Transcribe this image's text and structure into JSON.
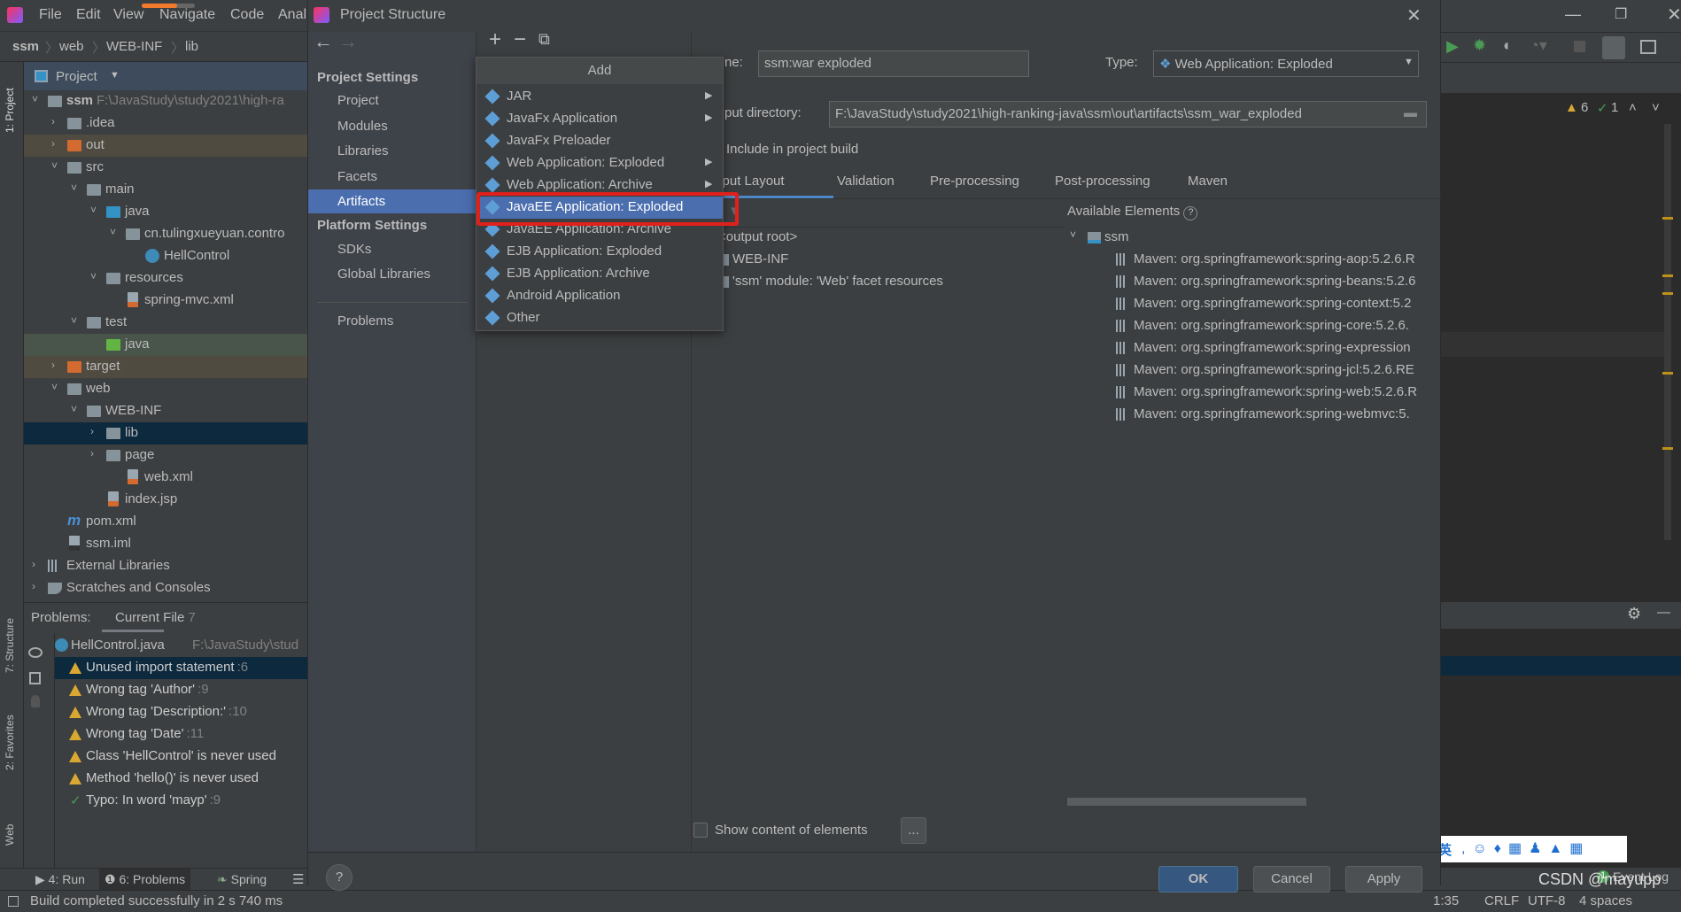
{
  "colors": {
    "selection": "#4b6eaf",
    "dark_selection": "#0d293e",
    "highlight_box": "#e0201a",
    "ok_button": "#365880",
    "excluded_row": "#4f4b41",
    "test_row": "#49544a"
  },
  "ide": {
    "menu": [
      "File",
      "Edit",
      "View",
      "Navigate",
      "Code",
      "Anal"
    ],
    "breadcrumb": [
      "ssm",
      "web",
      "WEB-INF",
      "lib"
    ],
    "left_strip": [
      "1: Project",
      "7: Structure",
      "2: Favorites",
      "Web"
    ],
    "project_header": "Project",
    "tree": [
      {
        "label": "ssm",
        "path": "F:\\JavaStudy\\study2021\\high-ra",
        "level": 0,
        "arrow": "open",
        "icon": "module-folder"
      },
      {
        "label": ".idea",
        "level": 1,
        "arrow": "closed",
        "icon": "folder"
      },
      {
        "label": "out",
        "level": 1,
        "arrow": "closed",
        "icon": "excluded-folder",
        "row": "excluded"
      },
      {
        "label": "src",
        "level": 1,
        "arrow": "open",
        "icon": "folder"
      },
      {
        "label": "main",
        "level": 2,
        "arrow": "open",
        "icon": "folder"
      },
      {
        "label": "java",
        "level": 3,
        "arrow": "open",
        "icon": "source-folder"
      },
      {
        "label": "cn.tulingxueyuan.contro",
        "level": 4,
        "arrow": "open",
        "icon": "package"
      },
      {
        "label": "HellControl",
        "level": 5,
        "arrow": "none",
        "icon": "class"
      },
      {
        "label": "resources",
        "level": 3,
        "arrow": "open",
        "icon": "resources-folder"
      },
      {
        "label": "spring-mvc.xml",
        "level": 4,
        "arrow": "none",
        "icon": "xml-file"
      },
      {
        "label": "test",
        "level": 2,
        "arrow": "open",
        "icon": "folder"
      },
      {
        "label": "java",
        "level": 3,
        "arrow": "none",
        "icon": "test-folder",
        "row": "test"
      },
      {
        "label": "target",
        "level": 1,
        "arrow": "closed",
        "icon": "excluded-folder",
        "row": "excluded"
      },
      {
        "label": "web",
        "level": 1,
        "arrow": "open",
        "icon": "web-folder"
      },
      {
        "label": "WEB-INF",
        "level": 2,
        "arrow": "open",
        "icon": "folder"
      },
      {
        "label": "lib",
        "level": 3,
        "arrow": "closed",
        "icon": "folder",
        "row": "selected"
      },
      {
        "label": "page",
        "level": 3,
        "arrow": "closed",
        "icon": "folder"
      },
      {
        "label": "web.xml",
        "level": 4,
        "arrow": "none",
        "icon": "xml-file"
      },
      {
        "label": "index.jsp",
        "level": 3,
        "arrow": "none",
        "icon": "jsp-file"
      },
      {
        "label": "pom.xml",
        "level": 1,
        "arrow": "none",
        "icon": "maven-file"
      },
      {
        "label": "ssm.iml",
        "level": 1,
        "arrow": "none",
        "icon": "iml-file"
      },
      {
        "label": "External Libraries",
        "level": 0,
        "arrow": "closed",
        "icon": "libraries"
      },
      {
        "label": "Scratches and Consoles",
        "level": 0,
        "arrow": "closed",
        "icon": "scratches"
      }
    ],
    "problems": {
      "label": "Problems:",
      "tab": "Current File",
      "count": "7",
      "file": "HellControl.java",
      "file_path": "F:\\JavaStudy\\stud",
      "items": [
        {
          "text": "Unused import statement",
          "line": ":6",
          "type": "warning"
        },
        {
          "text": "Wrong tag 'Author'",
          "line": ":9",
          "type": "warning"
        },
        {
          "text": "Wrong tag 'Description:'",
          "line": ":10",
          "type": "warning"
        },
        {
          "text": "Wrong tag 'Date'",
          "line": ":11",
          "type": "warning"
        },
        {
          "text": "Class 'HellControl' is never used",
          "line": "",
          "type": "warning"
        },
        {
          "text": "Method 'hello()' is never used",
          "line": "",
          "type": "warning"
        },
        {
          "text": "Typo: In word 'mayp'",
          "line": ":9",
          "type": "typo"
        }
      ]
    },
    "bottom_tabs": [
      "4: Run",
      "6: Problems",
      "Spring"
    ],
    "status_text": "Build completed successfully in 2 s 740 ms",
    "inspection": {
      "warnings": "6",
      "typos": "1"
    },
    "event_log": "Event Log",
    "event_count": "1",
    "status_right": [
      "1:35",
      "CRLF",
      "UTF-8",
      "4 spaces"
    ],
    "watermark": "CSDN @mayupp",
    "ime": "英"
  },
  "dialog": {
    "title": "Project Structure",
    "project_settings": "Project Settings",
    "project_items": [
      "Project",
      "Modules",
      "Libraries",
      "Facets",
      "Artifacts"
    ],
    "selected_item": "Artifacts",
    "platform_settings": "Platform Settings",
    "platform_items": [
      "SDKs",
      "Global Libraries"
    ],
    "problems": "Problems",
    "add_popup": {
      "title": "Add",
      "items": [
        {
          "label": "JAR",
          "submenu": true
        },
        {
          "label": "JavaFx Application",
          "submenu": true
        },
        {
          "label": "JavaFx Preloader",
          "submenu": false
        },
        {
          "label": "Web Application: Exploded",
          "submenu": true
        },
        {
          "label": "Web Application: Archive",
          "submenu": true
        },
        {
          "label": "JavaEE Application: Exploded",
          "submenu": false,
          "selected": true
        },
        {
          "label": "JavaEE Application: Archive",
          "submenu": false
        },
        {
          "label": "EJB Application: Exploded",
          "submenu": false
        },
        {
          "label": "EJB Application: Archive",
          "submenu": false
        },
        {
          "label": "Android Application",
          "submenu": false
        },
        {
          "label": "Other",
          "submenu": false
        }
      ]
    },
    "name_label": "ne:",
    "name_value": "ssm:war exploded",
    "type_label": "Type:",
    "type_value": "Web Application: Exploded",
    "output_label": "put directory:",
    "output_value": "F:\\JavaStudy\\study2021\\high-ranking-java\\ssm\\out\\artifacts\\ssm_war_exploded",
    "include_label": "Include in project build",
    "tabs": [
      "utput Layout",
      "Validation",
      "Pre-processing",
      "Post-processing",
      "Maven"
    ],
    "active_tab": "utput Layout",
    "layout_tree": [
      "<output root>",
      "WEB-INF",
      "'ssm' module: 'Web' facet resources"
    ],
    "available_label": "Available Elements",
    "available_root": "ssm",
    "available_items": [
      "Maven: org.springframework:spring-aop:5.2.6.R",
      "Maven: org.springframework:spring-beans:5.2.6",
      "Maven: org.springframework:spring-context:5.2",
      "Maven: org.springframework:spring-core:5.2.6.",
      "Maven: org.springframework:spring-expression",
      "Maven: org.springframework:spring-jcl:5.2.6.RE",
      "Maven: org.springframework:spring-web:5.2.6.R",
      "Maven: org.springframework:spring-webmvc:5."
    ],
    "show_content": "Show content of elements",
    "show_content_checked": false,
    "ellipsis": "...",
    "help": "?",
    "ok": "OK",
    "cancel": "Cancel",
    "apply": "Apply"
  }
}
